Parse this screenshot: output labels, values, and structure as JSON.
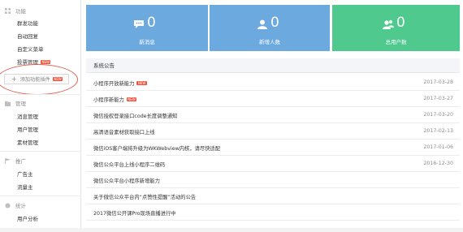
{
  "sidebar": {
    "sections": [
      {
        "label": "功能",
        "items": [
          {
            "label": "群发功能"
          },
          {
            "label": "自动回复"
          },
          {
            "label": "自定义菜单"
          },
          {
            "label": "投票管理",
            "badge": "NEW"
          }
        ]
      },
      {
        "label": "管理",
        "items": [
          {
            "label": "消息管理"
          },
          {
            "label": "用户管理"
          },
          {
            "label": "素材管理"
          }
        ]
      },
      {
        "label": "推广",
        "items": [
          {
            "label": "广告主"
          },
          {
            "label": "流量主"
          }
        ]
      },
      {
        "label": "统计",
        "items": [
          {
            "label": "用户分析"
          }
        ]
      }
    ],
    "add_plugin": {
      "label": "添加功能插件",
      "badge": "NEW"
    }
  },
  "stats": [
    {
      "value": "0",
      "label": "新消息",
      "icon": "message-icon",
      "color": "#6ca9df"
    },
    {
      "value": "0",
      "label": "新增人数",
      "icon": "user-icon",
      "color": "#6ca9df"
    },
    {
      "value": "0",
      "label": "总用户数",
      "icon": "users-icon",
      "color": "#4fc98e"
    }
  ],
  "announcements": {
    "title": "系统公告",
    "items": [
      {
        "title": "小程序开放新能力",
        "badge": "NEW",
        "date": "2017-03-28"
      },
      {
        "title": "小程序新能力",
        "badge": "NEW",
        "date": "2017-03-27"
      },
      {
        "title": "微信授权登录接口code长度调整通知",
        "date": "2017-03-20"
      },
      {
        "title": "高清语音素材获取接口上线",
        "date": "2017-02-13"
      },
      {
        "title": "微信iOS客户端将升级为WKWebview内核，请尽快适配",
        "date": "2017-01-06"
      },
      {
        "title": "微信公众平台上线小程序二维码",
        "date": "2016-12-30"
      },
      {
        "title": "微信公众平台小程序新增能力",
        "date": ""
      },
      {
        "title": "关于微信公众平台内“点赞性提醒”活动的公告",
        "date": ""
      },
      {
        "title": "2017微信公开课Pro现场直播进行中",
        "date": ""
      }
    ]
  }
}
